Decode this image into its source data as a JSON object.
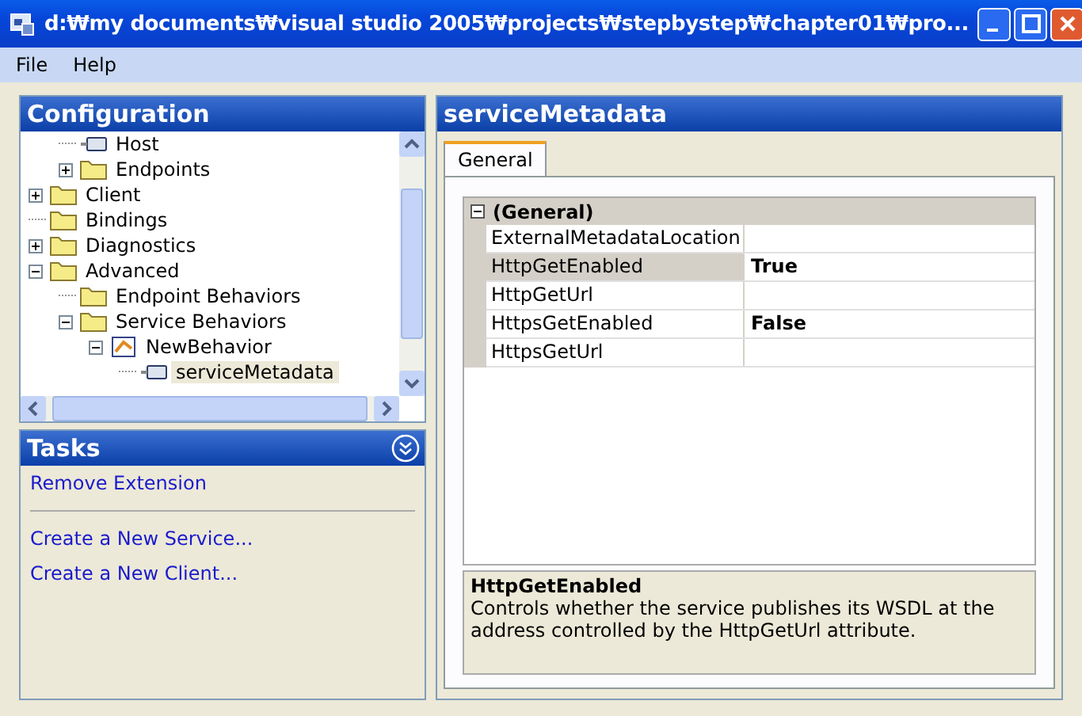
{
  "window": {
    "title": "d:₩my documents₩visual studio 2005₩projects₩stepbystep₩chapter01₩pro..."
  },
  "menu": [
    "File",
    "Help"
  ],
  "configuration": {
    "title": "Configuration",
    "tree": {
      "partial_branch": [
        {
          "label": "Host",
          "kind": "leaf",
          "selected": false
        },
        {
          "label": "Endpoints",
          "kind": "folder",
          "expanded": false,
          "selected": false
        }
      ],
      "items": [
        {
          "label": "Client",
          "kind": "folder",
          "expanded": false,
          "selected": false
        },
        {
          "label": "Bindings",
          "kind": "folder",
          "selected": false
        },
        {
          "label": "Diagnostics",
          "kind": "folder",
          "expanded": false,
          "selected": false
        },
        {
          "label": "Advanced",
          "kind": "folder",
          "expanded": true,
          "selected": false,
          "children": [
            {
              "label": "Endpoint Behaviors",
              "kind": "folder",
              "selected": false
            },
            {
              "label": "Service Behaviors",
              "kind": "folder",
              "expanded": true,
              "selected": false,
              "children": [
                {
                  "label": "NewBehavior",
                  "kind": "behavior",
                  "expanded": true,
                  "selected": false,
                  "children": [
                    {
                      "label": "serviceMetadata",
                      "kind": "leaf",
                      "selected": true
                    }
                  ]
                }
              ]
            }
          ]
        }
      ]
    }
  },
  "tasks": {
    "title": "Tasks",
    "groups": [
      [
        "Remove Extension"
      ],
      [
        "Create a New Service...",
        "Create a New Client..."
      ]
    ]
  },
  "editor": {
    "title": "serviceMetadata",
    "tabs": [
      {
        "label": "General",
        "selected": true
      }
    ],
    "category": {
      "label": "(General)",
      "expanded": true
    },
    "properties": [
      {
        "name": "ExternalMetadataLocation",
        "selected": false
      },
      {
        "name": "HttpGetEnabled",
        "value": "True",
        "selected": true
      },
      {
        "name": "HttpGetUrl",
        "selected": false
      },
      {
        "name": "HttpsGetEnabled",
        "value": "False",
        "selected": false
      },
      {
        "name": "HttpsGetUrl",
        "selected": false
      }
    ],
    "description": {
      "title": "HttpGetEnabled",
      "text": "Controls whether the service publishes its WSDL at the address controlled by the HttpGetUrl attribute."
    }
  }
}
